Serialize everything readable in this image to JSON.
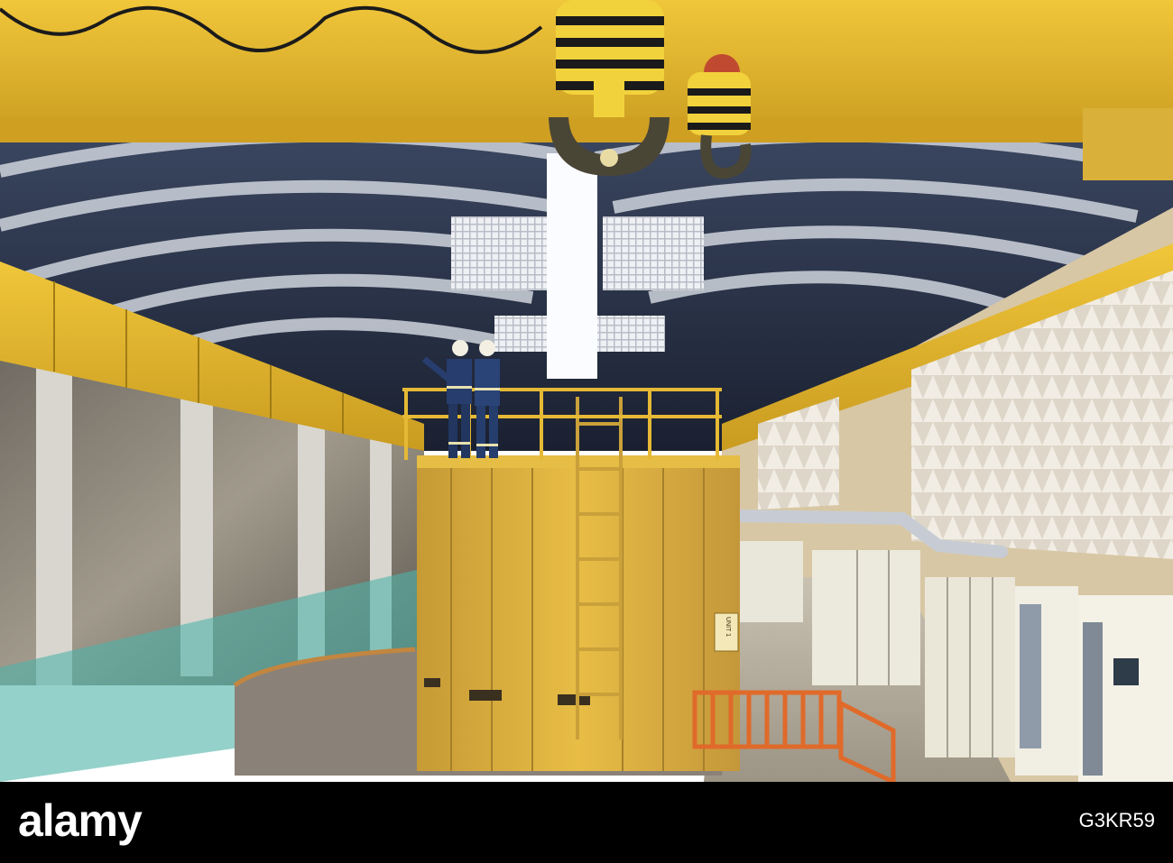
{
  "photo": {
    "signage": {
      "unit_label": "UNIT 1"
    }
  },
  "footer": {
    "brand": "alamy",
    "image_id": "G3KR59"
  },
  "colors": {
    "crane_yellow": "#e3b52a",
    "stator_yellow": "#d9ac33",
    "ceiling_dark": "#1d2436",
    "ceiling_light": "#cfd4dc",
    "rock_wall": "#8a8479",
    "barrier_orange": "#e06a2a",
    "netting_teal": "#4fb3a8"
  }
}
